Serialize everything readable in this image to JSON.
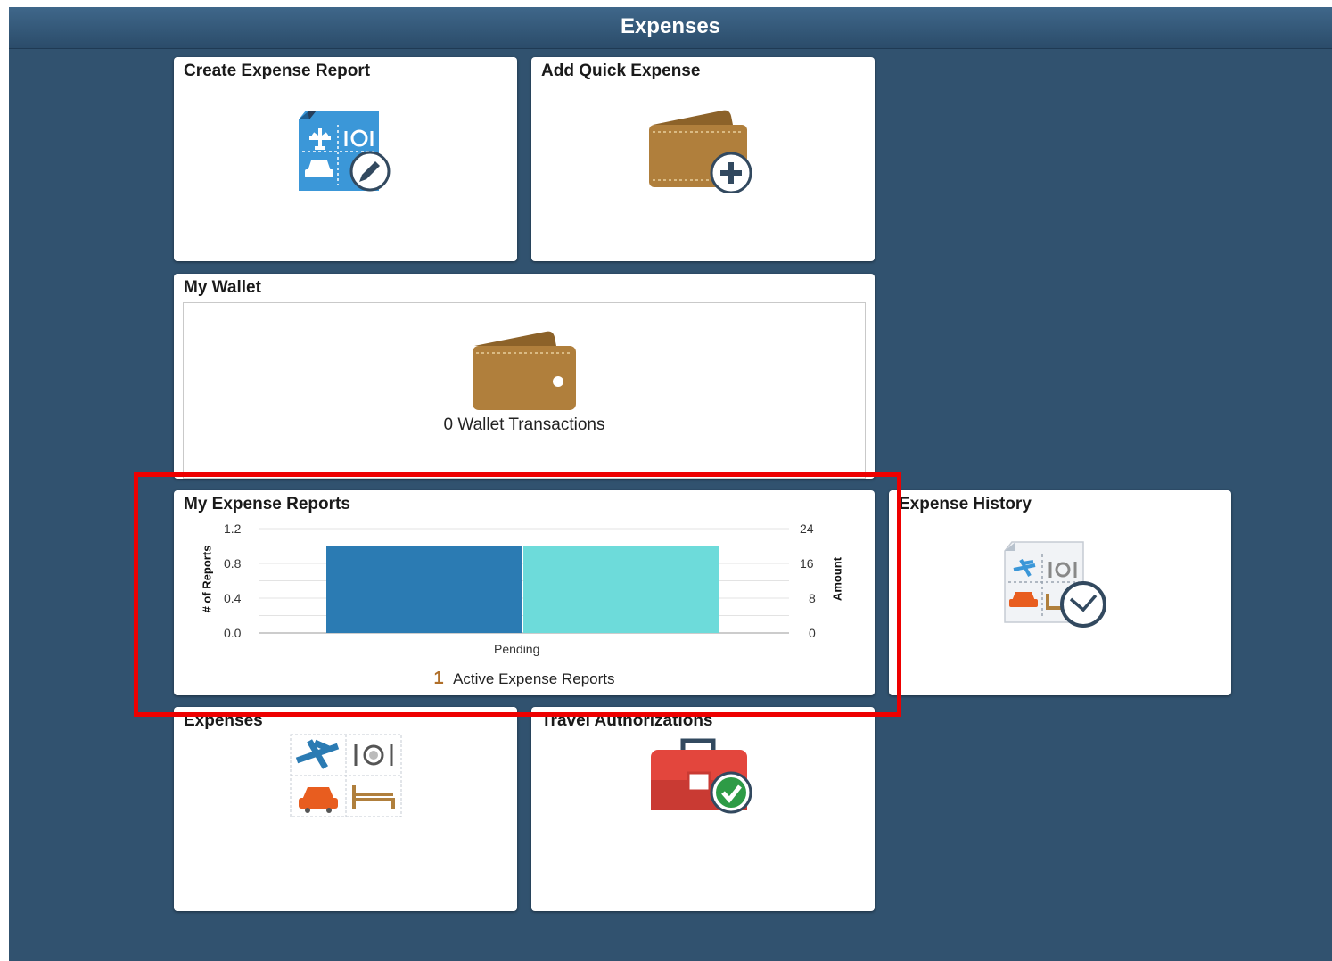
{
  "header": {
    "title": "Expenses"
  },
  "tiles": {
    "create_expense_report": {
      "title": "Create Expense Report",
      "icon": "expense-report-edit-icon"
    },
    "add_quick_expense": {
      "title": "Add Quick Expense",
      "icon": "wallet-add-icon"
    },
    "my_wallet": {
      "title": "My Wallet",
      "icon": "wallet-icon",
      "count_label": "0 Wallet Transactions"
    },
    "my_expense_reports": {
      "title": "My Expense Reports",
      "active_count": "1",
      "active_label": "Active Expense Reports"
    },
    "expense_history": {
      "title": "Expense History",
      "icon": "expense-history-clock-icon"
    },
    "expenses": {
      "title": "Expenses",
      "icon": "expense-categories-icon"
    },
    "travel_authorizations": {
      "title": "Travel Authorizations",
      "icon": "briefcase-check-icon"
    }
  },
  "chart_data": {
    "type": "bar",
    "categories": [
      "Pending"
    ],
    "series": [
      {
        "values": [
          1
        ],
        "axis": "left",
        "color": "#2b7bb3"
      },
      {
        "values": [
          20
        ],
        "axis": "right",
        "color": "#6ddbda"
      }
    ],
    "ylabel": "# of Reports",
    "y2label": "Amount",
    "ylim": [
      0,
      1.2
    ],
    "y2lim": [
      0,
      24
    ],
    "yticks": [
      "0.0",
      "0.4",
      "0.8",
      "1.2"
    ],
    "y2ticks": [
      "0",
      "8",
      "16",
      "24"
    ],
    "grid": true
  },
  "colors": {
    "background": "#31526f",
    "highlight": "#ee0000",
    "wallet": "#b07f3c",
    "report_blue": "#3b97d8",
    "count_accent": "#b06f2a"
  }
}
